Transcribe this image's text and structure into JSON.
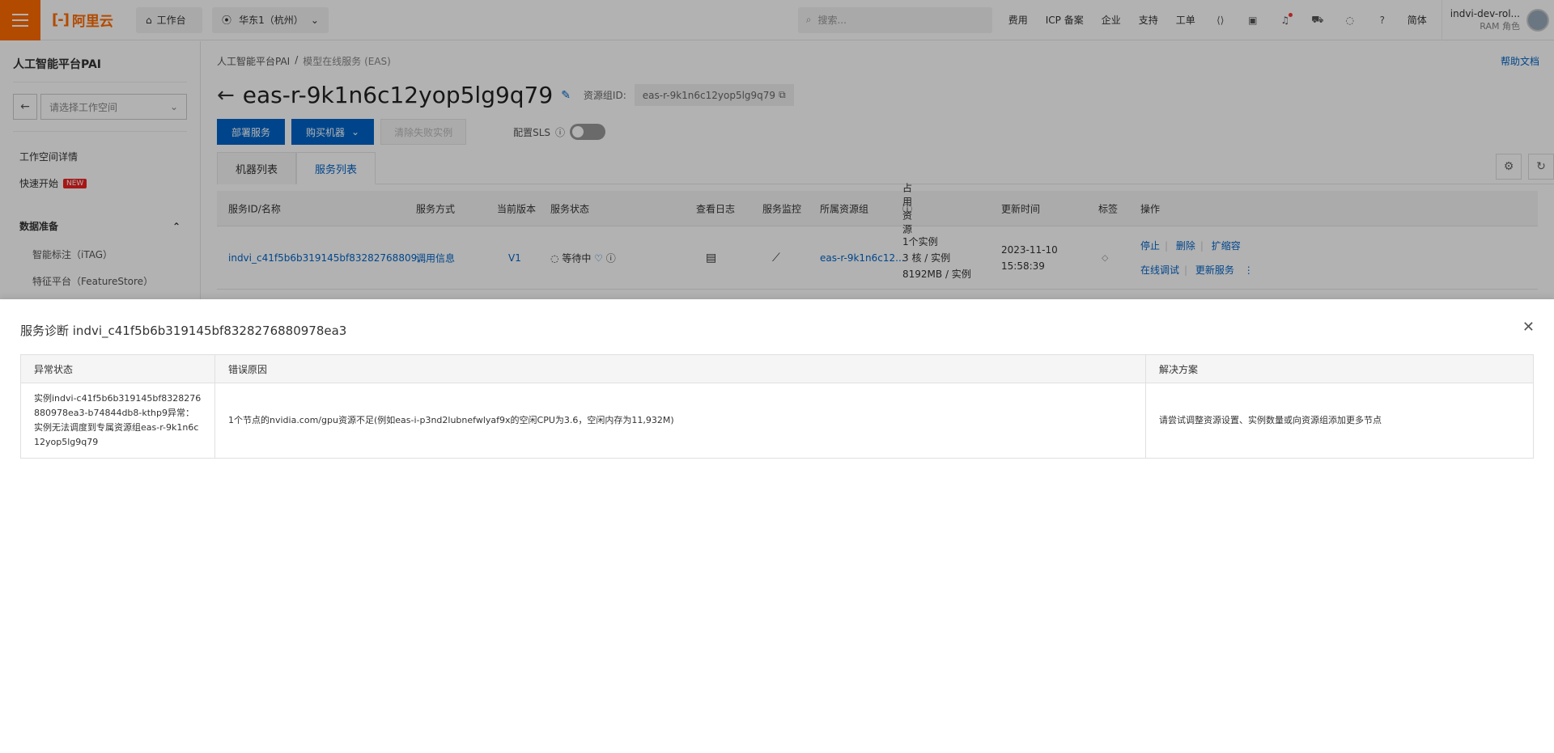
{
  "topbar": {
    "logo_text": "阿里云",
    "workspace_label": "工作台",
    "region_label": "华东1（杭州）",
    "search_placeholder": "搜索...",
    "links": [
      "费用",
      "ICP 备案",
      "企业",
      "支持",
      "工单"
    ],
    "lang": "简体",
    "user_name": "indvi-dev-rol...",
    "user_role": "RAM 角色"
  },
  "sidebar": {
    "title": "人工智能平台PAI",
    "workspace_placeholder": "请选择工作空间",
    "items": [
      "工作空间详情",
      "快速开始"
    ],
    "new_badge": "NEW",
    "group": "数据准备",
    "sub_items": [
      "智能标注（iTAG）",
      "特征平台（FeatureStore）"
    ]
  },
  "main": {
    "breadcrumb": [
      "人工智能平台PAI",
      "模型在线服务 (EAS)"
    ],
    "help_link": "帮助文档",
    "title": "eas-r-9k1n6c12yop5lg9q79",
    "resource_group_label": "资源组ID:",
    "resource_group_id": "eas-r-9k1n6c12yop5lg9q79",
    "buttons": {
      "deploy": "部署服务",
      "buy": "购买机器",
      "clear_failed": "清除失败实例"
    },
    "sls_label": "配置SLS",
    "tabs": [
      "机器列表",
      "服务列表"
    ],
    "table_headers": [
      "服务ID/名称",
      "服务方式",
      "当前版本",
      "服务状态",
      "查看日志",
      "服务监控",
      "所属资源组",
      "占用资源",
      "更新时间",
      "标签",
      "操作"
    ],
    "row": {
      "service_id": "indvi_c41f5b6b319145bf83282768809...",
      "method": "调用信息",
      "version": "V1",
      "status": "等待中",
      "resource_group": "eas-r-9k1n6c12...",
      "res_line1": "1个实例",
      "res_line2": "3 核 / 实例",
      "res_line3": "8192MB / 实例",
      "update_date": "2023-11-10",
      "update_time": "15:58:39",
      "ops": [
        "停止",
        "删除",
        "扩缩容",
        "在线调试",
        "更新服务"
      ]
    }
  },
  "drawer": {
    "title": "服务诊断 indvi_c41f5b6b319145bf8328276880978ea3",
    "headers": [
      "异常状态",
      "错误原因",
      "解决方案"
    ],
    "status": "实例indvi-c41f5b6b319145bf8328276880978ea3-b74844db8-kthp9异常：实例无法调度到专属资源组eas-r-9k1n6c12yop5lg9q79",
    "reason": "1个节点的nvidia.com/gpu资源不足(例如eas-i-p3nd2lubnefwlyaf9x的空闲CPU为3.6，空闲内存为11,932M)",
    "solution": "请尝试调整资源设置、实例数量或向资源组添加更多节点"
  }
}
